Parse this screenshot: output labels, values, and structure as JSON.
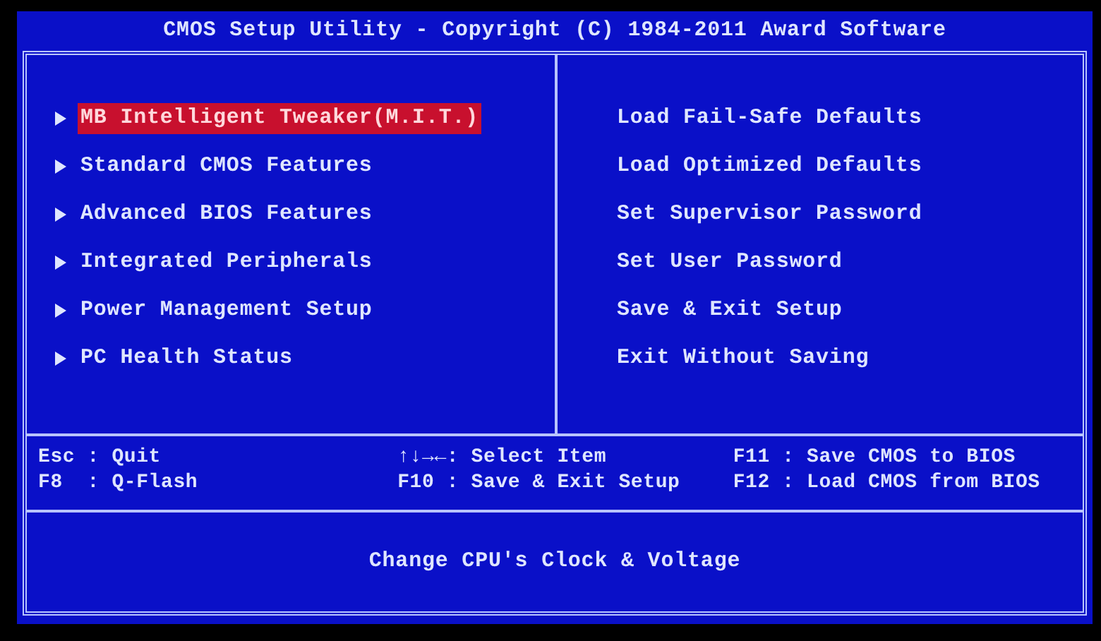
{
  "window": {
    "title": "CMOS Setup Utility - Copyright (C) 1984-2011 Award Software"
  },
  "left_menu": [
    {
      "label": "MB Intelligent Tweaker(M.I.T.)",
      "selected": true
    },
    {
      "label": "Standard CMOS Features",
      "selected": false
    },
    {
      "label": "Advanced BIOS Features",
      "selected": false
    },
    {
      "label": "Integrated Peripherals",
      "selected": false
    },
    {
      "label": "Power Management Setup",
      "selected": false
    },
    {
      "label": "PC Health Status",
      "selected": false
    }
  ],
  "right_menu": [
    {
      "label": "Load Fail-Safe Defaults",
      "selected": false
    },
    {
      "label": "Load Optimized Defaults",
      "selected": false
    },
    {
      "label": "Set Supervisor Password",
      "selected": false
    },
    {
      "label": "Set User Password",
      "selected": false
    },
    {
      "label": "Save & Exit Setup",
      "selected": false
    },
    {
      "label": "Exit Without Saving",
      "selected": false
    }
  ],
  "key_hints": [
    [
      "Esc : Quit",
      "F8  : Q-Flash"
    ],
    [
      "↑↓→←: Select Item",
      "F10 : Save & Exit Setup"
    ],
    [
      "F11 : Save CMOS to BIOS",
      "F12 : Load CMOS from BIOS"
    ]
  ],
  "help_text": "Change CPU's Clock & Voltage"
}
